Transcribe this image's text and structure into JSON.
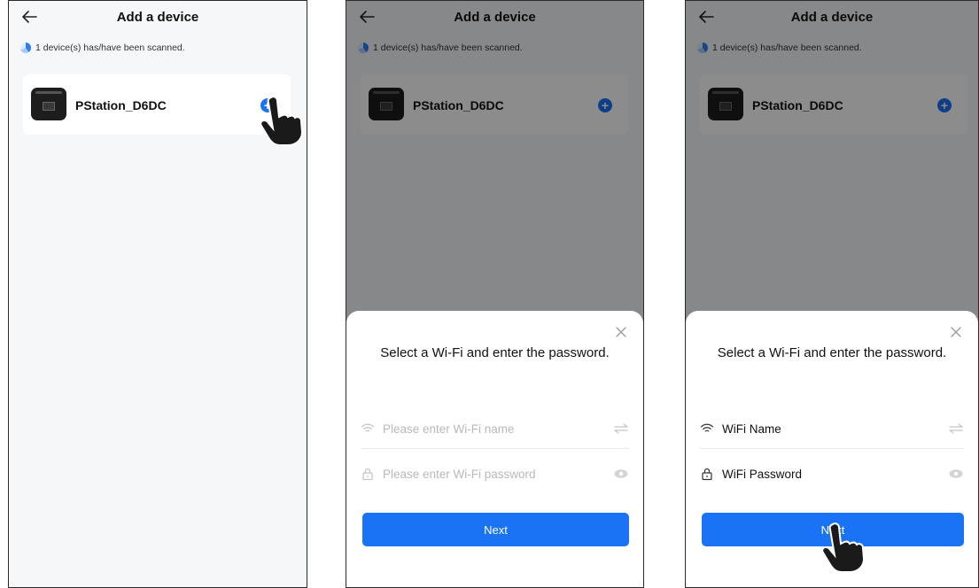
{
  "screens": [
    {
      "title": "Add a device",
      "scan_status": "1 device(s) has/have been scanned.",
      "device_name": "PStation_D6DC"
    },
    {
      "title": "Add a device",
      "scan_status": "1 device(s) has/have been scanned.",
      "device_name": "PStation_D6DC",
      "sheet": {
        "title": "Select a Wi-Fi and enter the password.",
        "wifi_placeholder": "Please enter Wi-Fi name",
        "password_placeholder": "Please enter Wi-Fi password",
        "next_label": "Next"
      }
    },
    {
      "title": "Add a device",
      "scan_status": "1 device(s) has/have been scanned.",
      "device_name": "PStation_D6DC",
      "sheet": {
        "title": "Select a Wi-Fi and enter the password.",
        "wifi_value": "WiFi Name",
        "password_value": "WiFi Password",
        "next_label": "Next"
      }
    }
  ],
  "icons": {
    "back": "back-arrow-icon",
    "add": "plus-circle-icon",
    "close": "close-icon",
    "wifi": "wifi-icon",
    "lock": "lock-icon",
    "swap": "swap-arrows-icon",
    "eye": "eye-icon",
    "hand": "pointing-hand-icon"
  },
  "colors": {
    "primary": "#1a73f5",
    "background": "#f6f7f9",
    "overlay": "rgba(0,0,0,0.45)"
  }
}
